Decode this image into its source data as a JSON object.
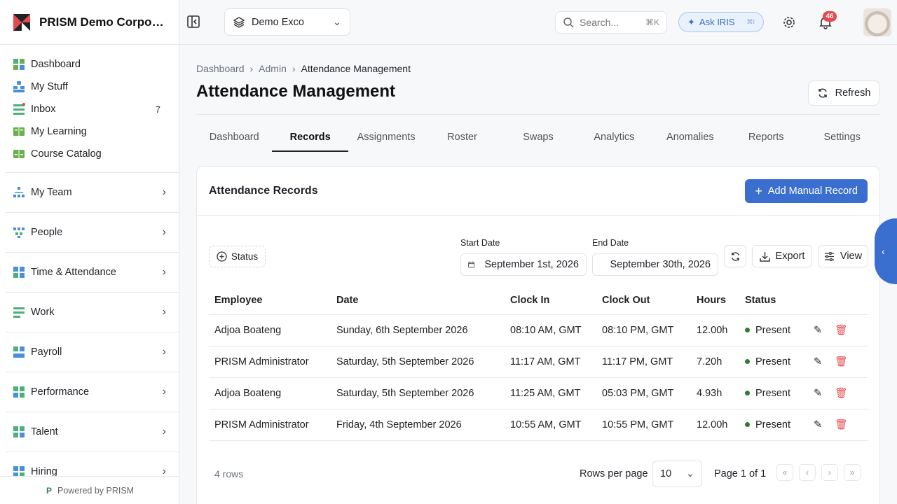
{
  "brand": {
    "name": "PRISM Demo Corporati..."
  },
  "sidebar": {
    "top_items": [
      {
        "label": "Dashboard",
        "icon": "dashboard-icon",
        "count": ""
      },
      {
        "label": "My Stuff",
        "icon": "my-stuff-icon",
        "count": ""
      },
      {
        "label": "Inbox",
        "icon": "inbox-icon",
        "count": "7"
      },
      {
        "label": "My Learning",
        "icon": "learning-icon",
        "count": ""
      },
      {
        "label": "Course Catalog",
        "icon": "catalog-icon",
        "count": ""
      }
    ],
    "groups": [
      {
        "label": "My Team"
      },
      {
        "label": "People"
      },
      {
        "label": "Time & Attendance"
      },
      {
        "label": "Work"
      },
      {
        "label": "Payroll"
      },
      {
        "label": "Performance"
      },
      {
        "label": "Talent"
      },
      {
        "label": "Hiring"
      }
    ],
    "powered_by": "Powered by PRISM"
  },
  "topbar": {
    "org_select": "Demo Exco",
    "search_placeholder": "Search...",
    "search_shortcut": "⌘K",
    "ask_label": "Ask IRIS",
    "ask_shortcut": "⌘I",
    "notification_count": "46"
  },
  "page": {
    "breadcrumbs": [
      "Dashboard",
      "Admin",
      "Attendance Management"
    ],
    "title": "Attendance Management",
    "refresh_label": "Refresh",
    "tabs": [
      "Dashboard",
      "Records",
      "Assignments",
      "Roster",
      "Swaps",
      "Analytics",
      "Anomalies",
      "Reports",
      "Settings"
    ],
    "active_tab": "Records"
  },
  "records": {
    "title": "Attendance Records",
    "add_label": "Add Manual Record",
    "status_filter": "Status",
    "start_date_label": "Start Date",
    "start_date": "September 1st, 2026",
    "end_date_label": "End Date",
    "end_date": "September 30th, 2026",
    "export_label": "Export",
    "view_label": "View",
    "columns": [
      "Employee",
      "Date",
      "Clock In",
      "Clock Out",
      "Hours",
      "Status"
    ],
    "rows": [
      [
        "Adjoa Boateng",
        "Sunday, 6th September 2026",
        "08:10 AM, GMT",
        "08:10 PM, GMT",
        "12.00h",
        "Present"
      ],
      [
        "PRISM Administrator",
        "Saturday, 5th September 2026",
        "11:17 AM, GMT",
        "11:17 PM, GMT",
        "7.20h",
        "Present"
      ],
      [
        "Adjoa Boateng",
        "Saturday, 5th September 2026",
        "11:25 AM, GMT",
        "05:03 PM, GMT",
        "4.93h",
        "Present"
      ],
      [
        "PRISM Administrator",
        "Friday, 4th September 2026",
        "10:55 AM, GMT",
        "10:55 PM, GMT",
        "12.00h",
        "Present"
      ]
    ],
    "row_count": "4 rows",
    "rows_per_page_label": "Rows per page",
    "rows_per_page": "10",
    "page_label": "Page 1 of 1"
  },
  "colors": {
    "accent": "#3b6fcf",
    "present": "#2e7d32",
    "delete": "#e5484d",
    "badge": "#e5484d"
  }
}
